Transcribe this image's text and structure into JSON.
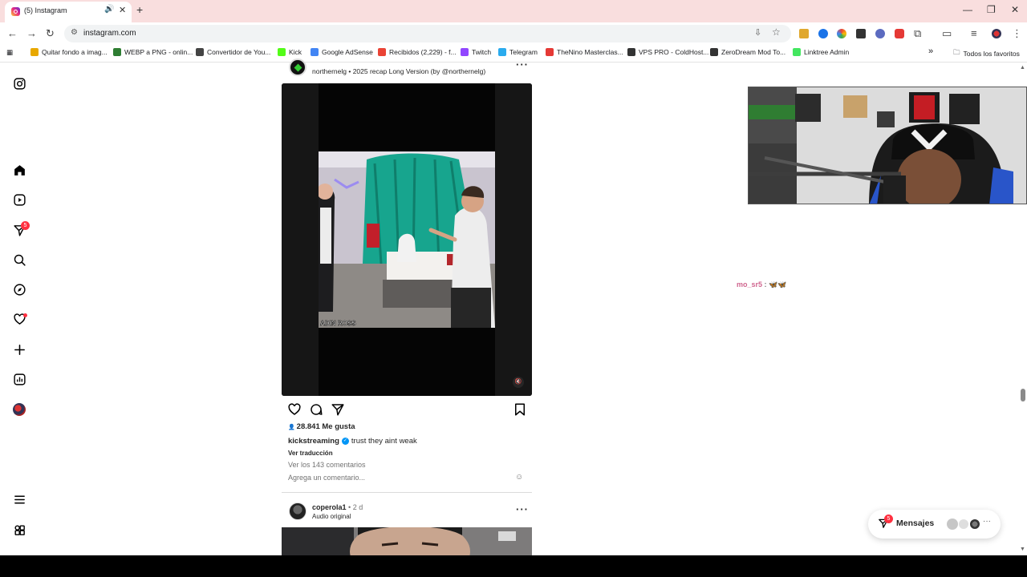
{
  "browser": {
    "tab": {
      "title": "(5) Instagram"
    },
    "address": {
      "url": "instagram.com"
    },
    "bookmarks": [
      {
        "label": "Quitar fondo a imag...",
        "color": "#e8a800"
      },
      {
        "label": "WEBP a PNG - onlin...",
        "color": "#2e7d32"
      },
      {
        "label": "Convertidor de You...",
        "color": "#444444"
      },
      {
        "label": "Kick",
        "color": "#53fc18"
      },
      {
        "label": "Google AdSense",
        "color": "#4285f4"
      },
      {
        "label": "Recibidos (2,229) - f...",
        "color": "#ea4335"
      },
      {
        "label": "Twitch",
        "color": "#9146ff"
      },
      {
        "label": "Telegram",
        "color": "#2aabee"
      },
      {
        "label": "TheNino Masterclas...",
        "color": "#e53935"
      },
      {
        "label": "VPS PRO - ColdHost...",
        "color": "#333333"
      },
      {
        "label": "ZeroDream Mod To...",
        "color": "#333333"
      },
      {
        "label": "Linktree Admin",
        "color": "#43e660"
      }
    ],
    "all_bookmarks": "Todos los favoritos"
  },
  "instagram": {
    "nav": {
      "notifications_badge": "5"
    },
    "post1": {
      "subtitle": "northernelg • 2025 recap Long Version (by @northernelg)",
      "video_watermark": "ADIN ROSS",
      "likes": "28.841 Me gusta",
      "caption_user": "kickstreaming",
      "caption_text": "trust they aint weak",
      "translate": "Ver traducción",
      "view_comments": "Ver los 143 comentarios",
      "comment_placeholder": "Agrega un comentario..."
    },
    "post2": {
      "user": "coperola1",
      "time": "• 2 d",
      "audio": "Audio original"
    },
    "messages": {
      "label": "Mensajes",
      "badge": "5"
    }
  },
  "stream_overlay": {
    "chat_user": "mo_sr5",
    "chat_separator": ":",
    "chat_message": "🦋🦋"
  }
}
